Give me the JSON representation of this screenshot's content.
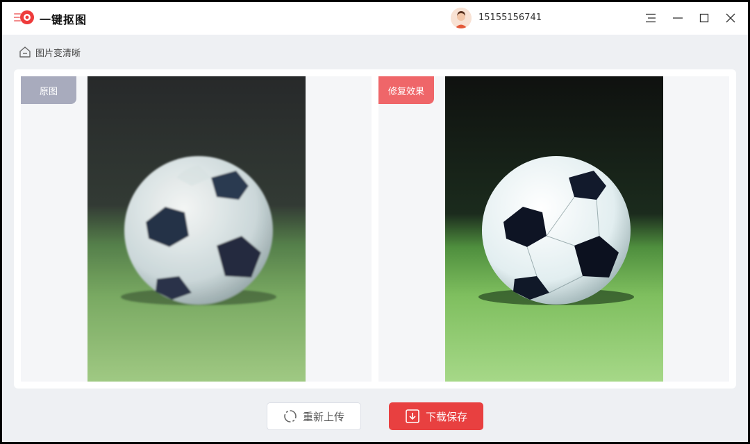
{
  "app": {
    "title": "一键抠图"
  },
  "user": {
    "phone": "15155156741"
  },
  "breadcrumb": {
    "label": "图片变清晰"
  },
  "comparison": {
    "original_label": "原图",
    "result_label": "修复效果"
  },
  "actions": {
    "reupload_label": "重新上传",
    "save_label": "下载保存"
  },
  "colors": {
    "accent": "#e84040",
    "original_tag": "#a8abbd",
    "result_tag": "#ef6669",
    "background": "#eef0f3"
  },
  "icons": {
    "logo": "logo-icon",
    "avatar": "avatar",
    "menu": "menu-icon",
    "minimize": "minimize-icon",
    "maximize": "maximize-icon",
    "close": "close-icon",
    "home": "home-icon",
    "refresh": "refresh-icon",
    "download": "download-icon"
  }
}
